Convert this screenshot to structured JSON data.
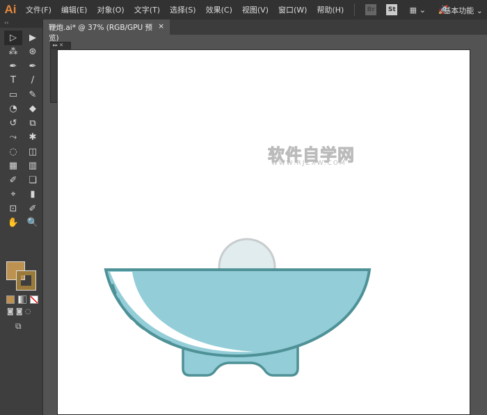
{
  "app": {
    "logo": "Ai",
    "workspace": "基本功能 ⌄"
  },
  "menu": [
    "文件(F)",
    "编辑(E)",
    "对象(O)",
    "文字(T)",
    "选择(S)",
    "效果(C)",
    "视图(V)",
    "窗口(W)",
    "帮助(H)"
  ],
  "appbar_icons": [
    "Br",
    "St",
    "▦ ⌄",
    "🚀"
  ],
  "tab": {
    "title": "鞭炮.ai* @ 37% (RGB/GPU 预览)",
    "close": "×"
  },
  "tools": [
    "▷",
    "▶",
    "⁂",
    "⊛",
    "✒",
    "✒",
    "T",
    "/",
    "▭",
    "✎",
    "◔",
    "◆",
    "↺",
    "⧉",
    "⤳",
    "✱",
    "◌",
    "◫",
    "▦",
    "▥",
    "✐",
    "❏",
    "⌖",
    "▮",
    "⊡",
    "✐",
    "✋",
    "🔍"
  ],
  "colors": {
    "fill": "#bd9150",
    "stroke": "#9a7a3a",
    "bowl_fill": "#93cdd8",
    "bowl_stroke": "#4e9196",
    "ball_fill": "#e0ecee",
    "ball_stroke": "#c8cccd"
  },
  "panel_icons": [
    "⬚",
    "⊏",
    "⧉"
  ],
  "watermark": {
    "title": "软件自学网",
    "url": "WWW.RJZXW.COM"
  }
}
